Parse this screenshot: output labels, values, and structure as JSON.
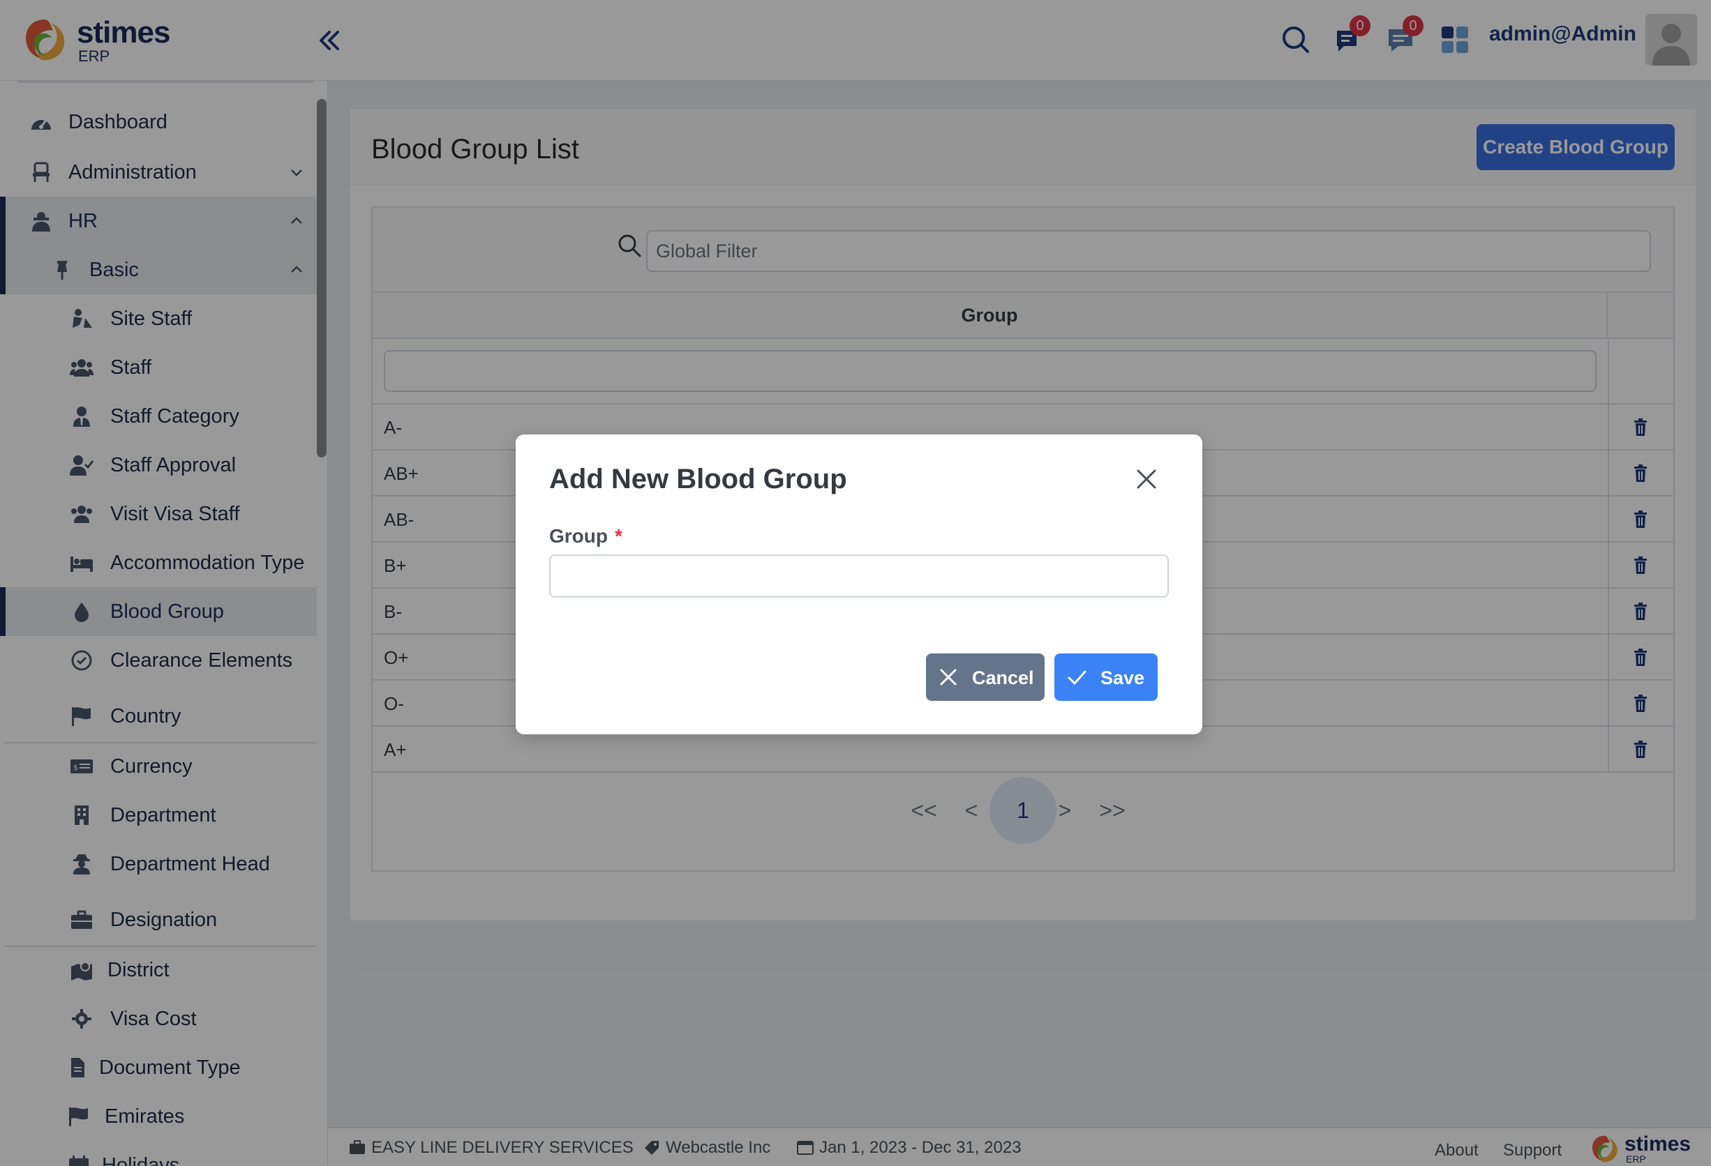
{
  "app": {
    "logo_text": "stimes",
    "logo_sub": "ERP",
    "username": "admin@Admin",
    "notifications_count": "0",
    "messages_count": "0"
  },
  "sidebar": {
    "items": [
      {
        "label": "Dashboard",
        "icon": "dashboard-icon"
      },
      {
        "label": "Administration",
        "icon": "chair-icon"
      },
      {
        "label": "HR",
        "icon": "hr-icon"
      },
      {
        "label": "Basic",
        "icon": "pin-icon"
      },
      {
        "label": "Site Staff",
        "icon": "digging-icon"
      },
      {
        "label": "Staff",
        "icon": "users-icon"
      },
      {
        "label": "Staff Category",
        "icon": "user-tie-icon"
      },
      {
        "label": "Staff Approval",
        "icon": "user-check-icon"
      },
      {
        "label": "Visit Visa Staff",
        "icon": "users-icon"
      },
      {
        "label": "Accommodation Type",
        "icon": "bed-icon"
      },
      {
        "label": "Blood Group",
        "icon": "droplet-icon"
      },
      {
        "label": "Clearance Elements",
        "icon": "check-circle-icon"
      },
      {
        "label": "Country",
        "icon": "flag-icon"
      },
      {
        "label": "Currency",
        "icon": "money-icon"
      },
      {
        "label": "Department",
        "icon": "building-icon"
      },
      {
        "label": "Department Head",
        "icon": "user-secret-icon"
      },
      {
        "label": "Designation",
        "icon": "briefcase-icon"
      },
      {
        "label": "District",
        "icon": "map-marker-icon"
      },
      {
        "label": "Visa Cost",
        "icon": "gear-icon"
      },
      {
        "label": "Document Type",
        "icon": "file-icon"
      },
      {
        "label": "Emirates",
        "icon": "flag-icon"
      },
      {
        "label": "Holidays",
        "icon": "calendar-icon"
      }
    ]
  },
  "page": {
    "title": "Blood Group List",
    "create_button": "Create Blood Group",
    "filter_placeholder": "Global Filter",
    "column_header": "Group",
    "rows": [
      "A-",
      "AB+",
      "AB-",
      "B+",
      "B-",
      "O+",
      "O-",
      "A+"
    ],
    "pagination": {
      "first": "<<",
      "prev": "<",
      "current": "1",
      "next": ">",
      "last": ">>"
    }
  },
  "modal": {
    "title": "Add New Blood Group",
    "field_label": "Group",
    "required_mark": "*",
    "field_value": "",
    "cancel_label": "Cancel",
    "save_label": "Save"
  },
  "footer": {
    "company": "EASY LINE DELIVERY SERVICES",
    "branch": "Webcastle Inc",
    "period": "Jan 1, 2023 - Dec 31, 2023",
    "about": "About",
    "support": "Support"
  },
  "colors": {
    "accent": "#3b6fe0",
    "brand_navy": "#1e2a5a",
    "danger": "#dc3545",
    "cancel_gray": "#64748b"
  }
}
